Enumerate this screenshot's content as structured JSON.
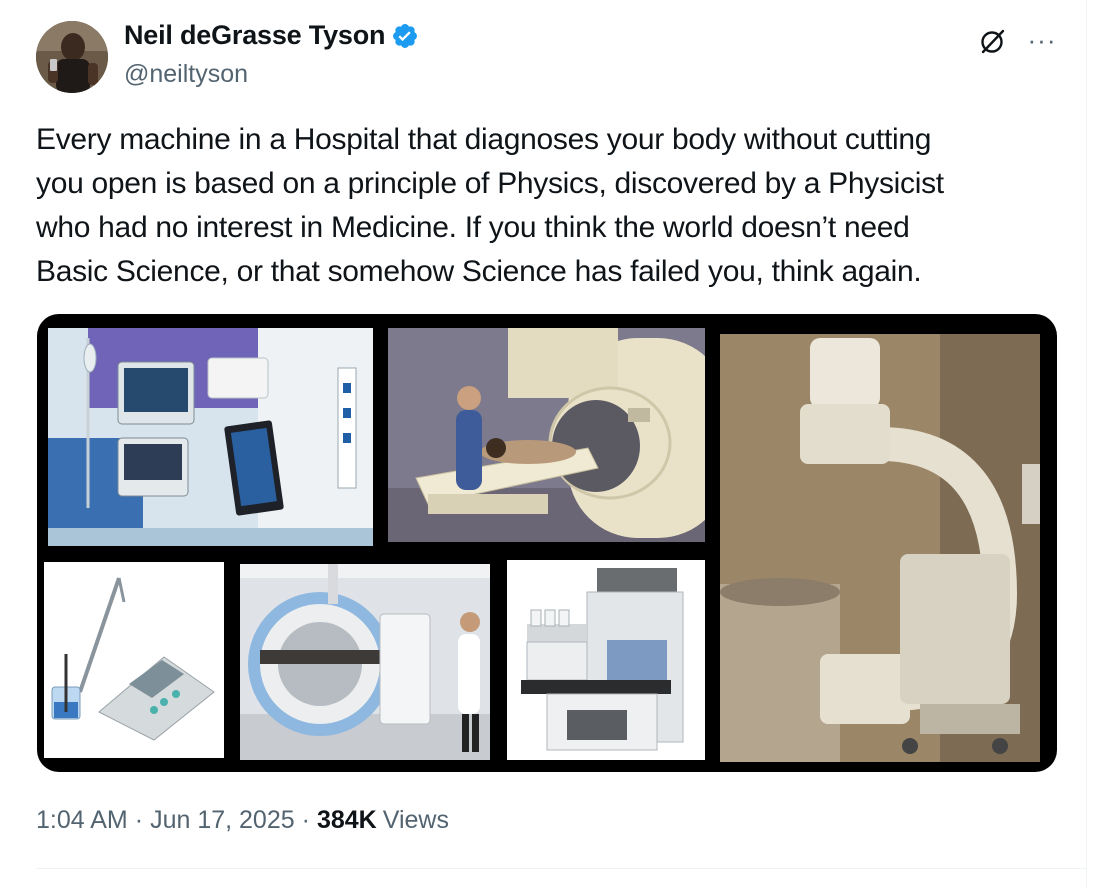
{
  "author": {
    "display_name": "Neil deGrasse Tyson",
    "handle": "@neiltyson",
    "verified": true,
    "avatar_icon": "profile-photo",
    "verified_icon": "verified-badge-icon"
  },
  "actions": {
    "grok_icon": "grok-icon",
    "more_icon": "more-options-icon",
    "more_label": "···"
  },
  "tweet": {
    "text": "Every machine in a Hospital that diagnoses your body without cutting\nyou open is based on a principle of Physics, discovered by a Physicist\nwho had no interest in Medicine. If you think the world doesn’t need\nBasic Science, or that somehow Science has failed you, think again."
  },
  "media": {
    "photos": [
      "icu-monitors-photo",
      "mri-scanner-photo",
      "c-arm-xray-photo",
      "ph-meter-photo",
      "radiation-therapy-photo",
      "mass-spectrometer-photo"
    ]
  },
  "meta": {
    "time": "1:04 AM",
    "separator": "·",
    "date": "Jun 17, 2025",
    "views_count": "384K",
    "views_label": "Views"
  },
  "colors": {
    "text_primary": "#0f1419",
    "text_secondary": "#536471",
    "verified_blue": "#1d9bf0",
    "divider": "#eff3f4"
  }
}
